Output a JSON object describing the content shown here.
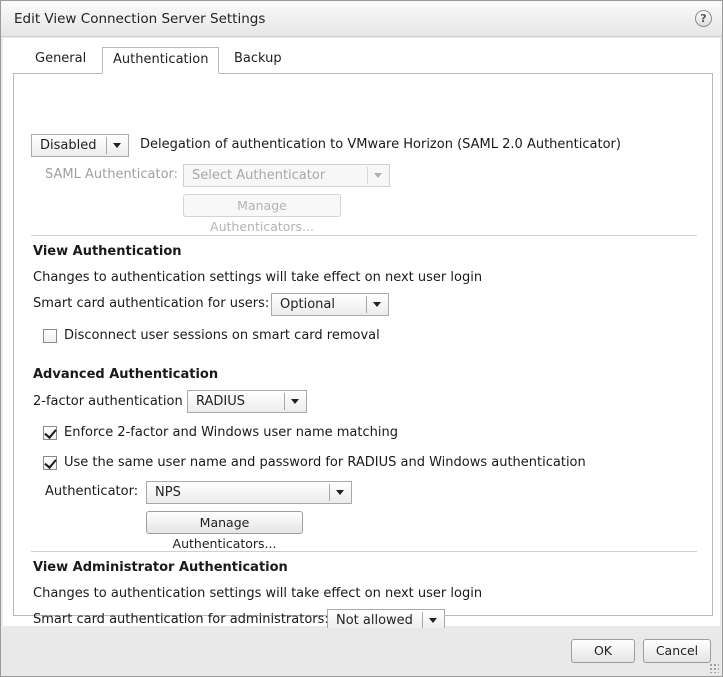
{
  "window": {
    "title": "Edit View Connection Server Settings",
    "help_glyph": "?"
  },
  "tabs": [
    {
      "label": "General",
      "active": false
    },
    {
      "label": "Authentication",
      "active": true
    },
    {
      "label": "Backup",
      "active": false
    }
  ],
  "delegation": {
    "value": "Disabled",
    "description": "Delegation of authentication to VMware Horizon (SAML 2.0 Authenticator)",
    "saml_label": "SAML Authenticator:",
    "saml_placeholder": "Select Authenticator",
    "manage_label": "Manage Authenticators..."
  },
  "view_auth": {
    "heading": "View Authentication",
    "note": "Changes to authentication settings will take effect on next user login",
    "smart_card_label": "Smart card authentication for users:",
    "smart_card_value": "Optional",
    "disconnect_label": "Disconnect user sessions on smart card removal",
    "disconnect_checked": false
  },
  "advanced_auth": {
    "heading": "Advanced Authentication",
    "two_factor_label": "2-factor authentication",
    "two_factor_value": "RADIUS",
    "enforce_label": "Enforce 2-factor and Windows user name matching",
    "enforce_checked": true,
    "same_creds_label": "Use the same user name and password for RADIUS and Windows authentication",
    "same_creds_checked": true,
    "authenticator_label": "Authenticator:",
    "authenticator_value": "NPS",
    "manage_label": "Manage Authenticators..."
  },
  "admin_auth": {
    "heading": "View Administrator Authentication",
    "note": "Changes to authentication settings will take effect on next user login",
    "smart_card_label": "Smart card authentication for administrators:",
    "smart_card_value": "Not allowed"
  },
  "footer": {
    "ok_label": "OK",
    "cancel_label": "Cancel"
  }
}
